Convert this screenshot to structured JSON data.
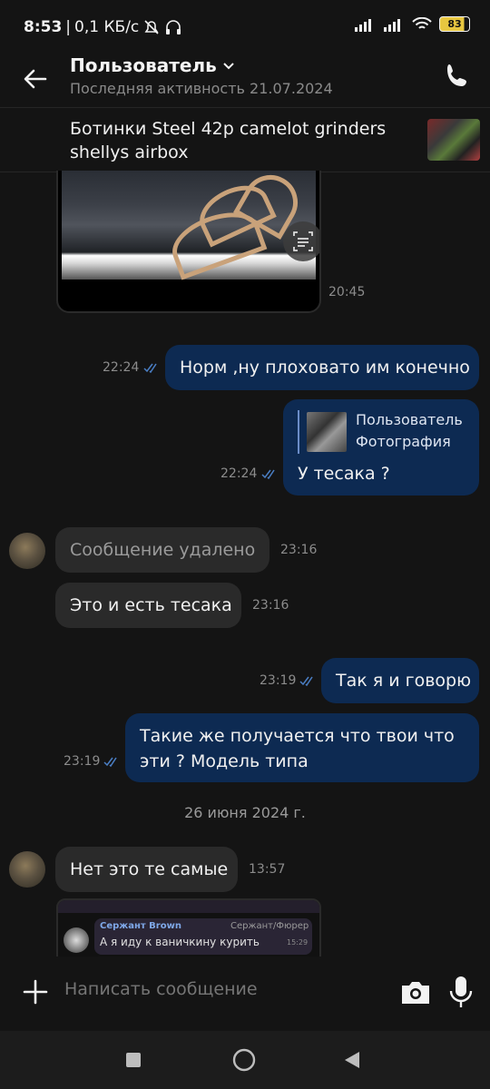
{
  "status": {
    "time": "8:53",
    "net": "0,1 КБ/с",
    "battery": "83"
  },
  "header": {
    "title": "Пользователь",
    "subtitle": "Последняя активность 21.07.2024"
  },
  "product": {
    "title": "Ботинки Steel 42р camelot grinders shellys airbox"
  },
  "messages": [
    {
      "dir": "in",
      "type": "photo",
      "time": "20:45"
    },
    {
      "dir": "out",
      "text": "Норм ,ну плоховато им конечно",
      "time": "22:24"
    },
    {
      "dir": "out",
      "reply_name": "Пользователь",
      "reply_type": "Фотография",
      "text": "У тесака ?",
      "time": "22:24"
    },
    {
      "dir": "in",
      "text": "Сообщение удалено",
      "time": "23:16",
      "deleted": true
    },
    {
      "dir": "in",
      "text": "Это и есть тесака",
      "time": "23:16"
    },
    {
      "dir": "out",
      "text": "Так я и говорю",
      "time": "23:19"
    },
    {
      "dir": "out",
      "text": "Такие же получается что твои что эти ? Модель типа",
      "time": "23:19"
    },
    {
      "dir": "in",
      "text": "Нет это те самые",
      "time": "13:57"
    },
    {
      "dir": "in",
      "type": "screenshot",
      "shot_name": "Сержант Brown",
      "shot_role": "Сержант/Фюрер",
      "shot_text": "А я иду к ваничкину курить",
      "shot_time": "15:29"
    }
  ],
  "date_separator": "26 июня 2024 г.",
  "composer": {
    "placeholder": "Написать сообщение"
  },
  "colors": {
    "background": "#141414",
    "outgoing_bubble": "#0d2a52",
    "incoming_bubble": "#2a2a2a",
    "read_ticks": "#4a7ec4"
  }
}
